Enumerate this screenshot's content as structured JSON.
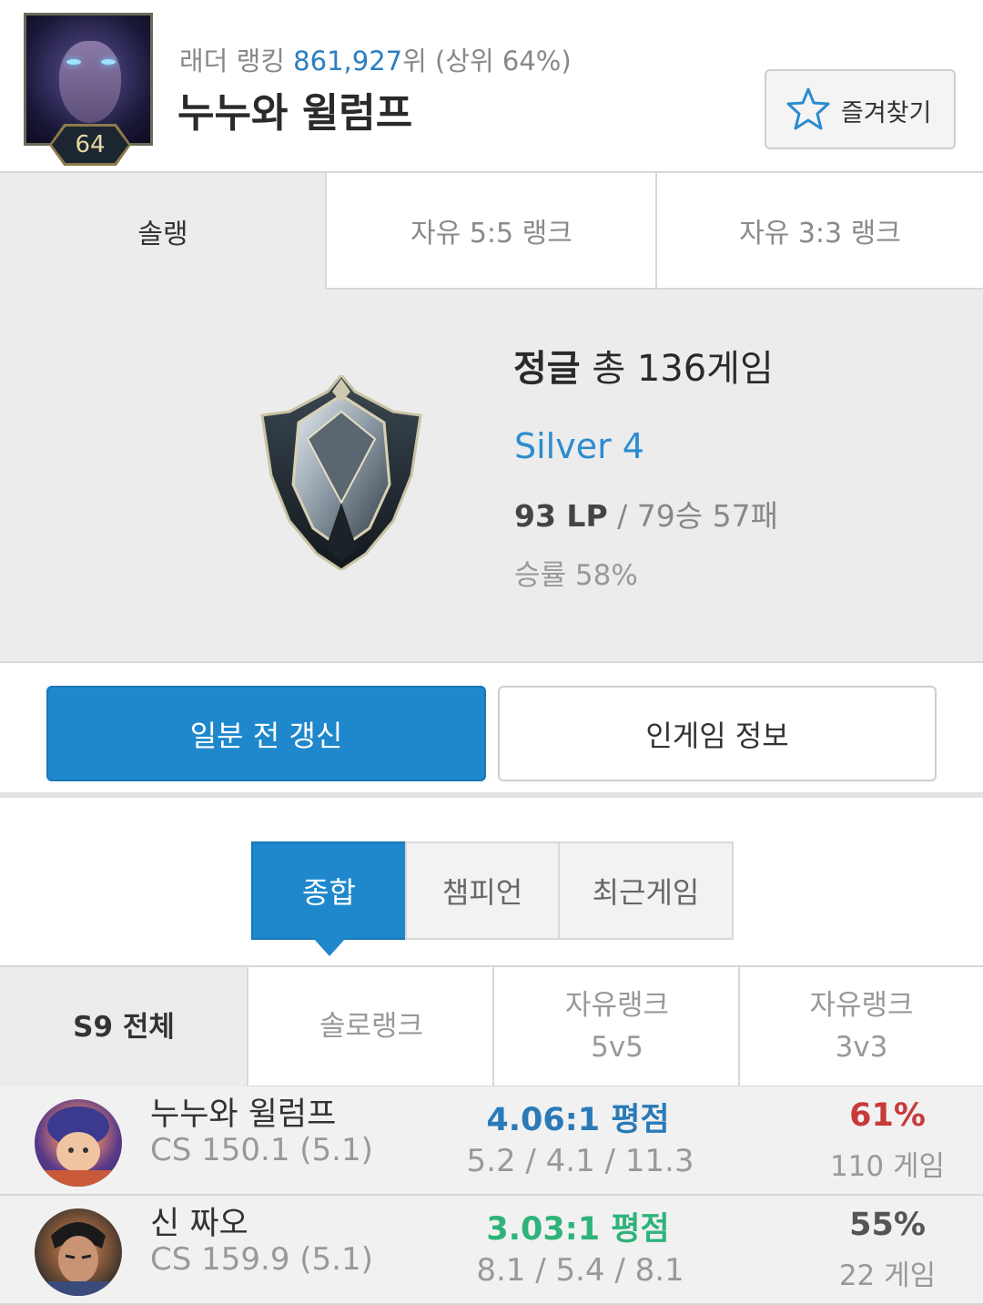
{
  "header": {
    "level": "64",
    "ladder_label": "래더 랭킹 ",
    "ladder_rank": "861,927",
    "ladder_suffix": "위 (상위 64%)",
    "summoner_name": "누누와 윌럼프",
    "favorite_label": "즐겨찾기"
  },
  "queue_tabs": [
    {
      "label": "솔랭",
      "active": true
    },
    {
      "label": "자유 5:5 랭크",
      "active": false
    },
    {
      "label": "자유 3:3 랭크",
      "active": false
    }
  ],
  "rank": {
    "position": "정글",
    "games_text": " 총 136게임",
    "tier": "Silver 4",
    "lp": "93 LP",
    "record": " / 79승 57패",
    "winrate": "승률 58%"
  },
  "actions": {
    "refresh_label": "일분 전 갱신",
    "ingame_label": "인게임 정보"
  },
  "view_tabs": [
    {
      "label": "종합",
      "active": true
    },
    {
      "label": "챔피언",
      "active": false
    },
    {
      "label": "최근게임",
      "active": false
    }
  ],
  "season_tabs": [
    {
      "line1": "S9 전체",
      "line2": "",
      "active": true
    },
    {
      "line1": "솔로랭크",
      "line2": "",
      "active": false
    },
    {
      "line1": "자유랭크",
      "line2": "5v5",
      "active": false
    },
    {
      "line1": "자유랭크",
      "line2": "3v3",
      "active": false
    }
  ],
  "champions": [
    {
      "name": "누누와 윌럼프",
      "cs": "CS 150.1 (5.1)",
      "kda": "4.06:1 평점",
      "kda_color": "#2a7ab8",
      "avg": "5.2 / 4.1 / 11.3",
      "winrate": "61%",
      "winrate_color": "#c83a3a",
      "games": "110 게임",
      "icon": "nunu-icon"
    },
    {
      "name": "신 짜오",
      "cs": "CS 159.9 (5.1)",
      "kda": "3.03:1 평점",
      "kda_color": "#2fb37a",
      "avg": "8.1 / 5.4 / 8.1",
      "winrate": "55%",
      "winrate_color": "#555555",
      "games": "22 게임",
      "icon": "xinzhao-icon"
    }
  ],
  "colors": {
    "accent": "#1f88cc",
    "tier": "#2b8ccf"
  }
}
